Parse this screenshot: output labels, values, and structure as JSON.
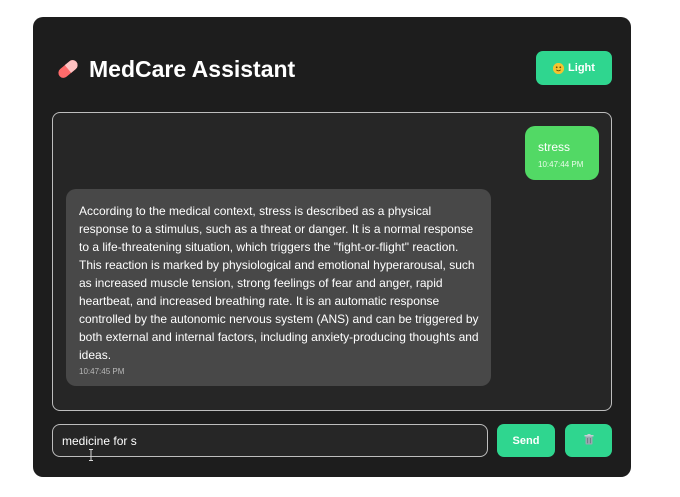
{
  "header": {
    "title": "MedCare Assistant",
    "logo_icon": "pill-icon",
    "theme_button": {
      "label": "Light",
      "icon": "emoji-face-icon"
    }
  },
  "messages": [
    {
      "role": "user",
      "text": "stress",
      "time": "10:47:44 PM"
    },
    {
      "role": "assistant",
      "text": "According to the medical context, stress is described as a physical response to a stimulus, such as a threat or danger. It is a normal response to a life-threatening situation, which triggers the \"fight-or-flight\" reaction. This reaction is marked by physiological and emotional hyperarousal, such as increased muscle tension, strong feelings of fear and anger, rapid heartbeat, and increased breathing rate. It is an automatic response controlled by the autonomic nervous system (ANS) and can be triggered by both external and internal factors, including anxiety-producing thoughts and ideas.",
      "time": "10:47:45 PM"
    }
  ],
  "input": {
    "value": "medicine for s",
    "placeholder": ""
  },
  "send_button": {
    "label": "Send"
  },
  "clear_button": {
    "icon": "trash-icon"
  },
  "colors": {
    "accent": "#2fd68f",
    "user_bubble": "#52d965",
    "bot_bubble": "#484848",
    "panel": "#1d1d1d"
  }
}
